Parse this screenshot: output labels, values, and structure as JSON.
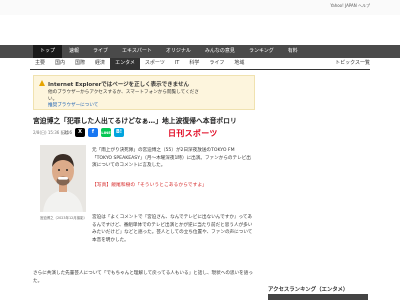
{
  "toplinks": {
    "text": "Yahoo! JAPAN ヘルプ"
  },
  "nav": [
    {
      "label": "トップ",
      "active": true
    },
    {
      "label": "速報",
      "active": false
    },
    {
      "label": "ライブ",
      "active": false
    },
    {
      "label": "エキスパート",
      "active": false
    },
    {
      "label": "オリジナル",
      "active": false
    },
    {
      "label": "みんなの意見",
      "active": false
    },
    {
      "label": "ランキング",
      "active": false
    },
    {
      "label": "有料",
      "active": false
    }
  ],
  "subnav": [
    {
      "label": "主要",
      "active": false
    },
    {
      "label": "国内",
      "active": false
    },
    {
      "label": "国際",
      "active": false
    },
    {
      "label": "経済",
      "active": false
    },
    {
      "label": "エンタメ",
      "active": true
    },
    {
      "label": "スポーツ",
      "active": false
    },
    {
      "label": "IT",
      "active": false
    },
    {
      "label": "科学",
      "active": false
    },
    {
      "label": "ライフ",
      "active": false
    },
    {
      "label": "地域",
      "active": false
    }
  ],
  "subnav_right": "トピックス一覧",
  "alert": {
    "title": "Internet Explorerではページを正しく表示できません",
    "body1": "他のブラウザーからアクセスするか、スマートフォンから閲覧してくださ",
    "body2": "い。",
    "link": "推奨ブラウザーについて"
  },
  "article": {
    "title": "宮迫博之「犯罪した人出てるけどなぁ…」地上波復帰へ本音ポロリ",
    "meta": "2/8(日) 15:36 配信",
    "share_count": "216",
    "brand": "日刊スポーツ",
    "caption": "宮迫博之（2023年12月撮影）",
    "p1": "元「雨上がり決死隊」の宮迫博之（55）が2日深夜放送のTOKYO FM「TOKYO SPEAKEASY」（月〜木曜深夜1時）に出演。ファンからのテレビ出演についてのコメントに言及した。",
    "related": "【写真】飯尾和樹の「そういうとこあるからですよ」",
    "p2": "宮迫は「よくコメントで『宮迫さん、なんでテレビに出ないんですか』ってあるんですけど、番組単体でのテレビ出演とかが逆に当たり前だと思う人が多いみたいだけど」などと語った。芸人としての立ち位置や、ファンの声について本音を明かした。",
    "p3": "さらに共演した先輩芸人について「でもちゃんと理解して戻ってる人もいる」と話し、現状への思いを語った。"
  },
  "sidebar": {
    "ranking_title": "アクセスランキング（エンタメ）"
  }
}
